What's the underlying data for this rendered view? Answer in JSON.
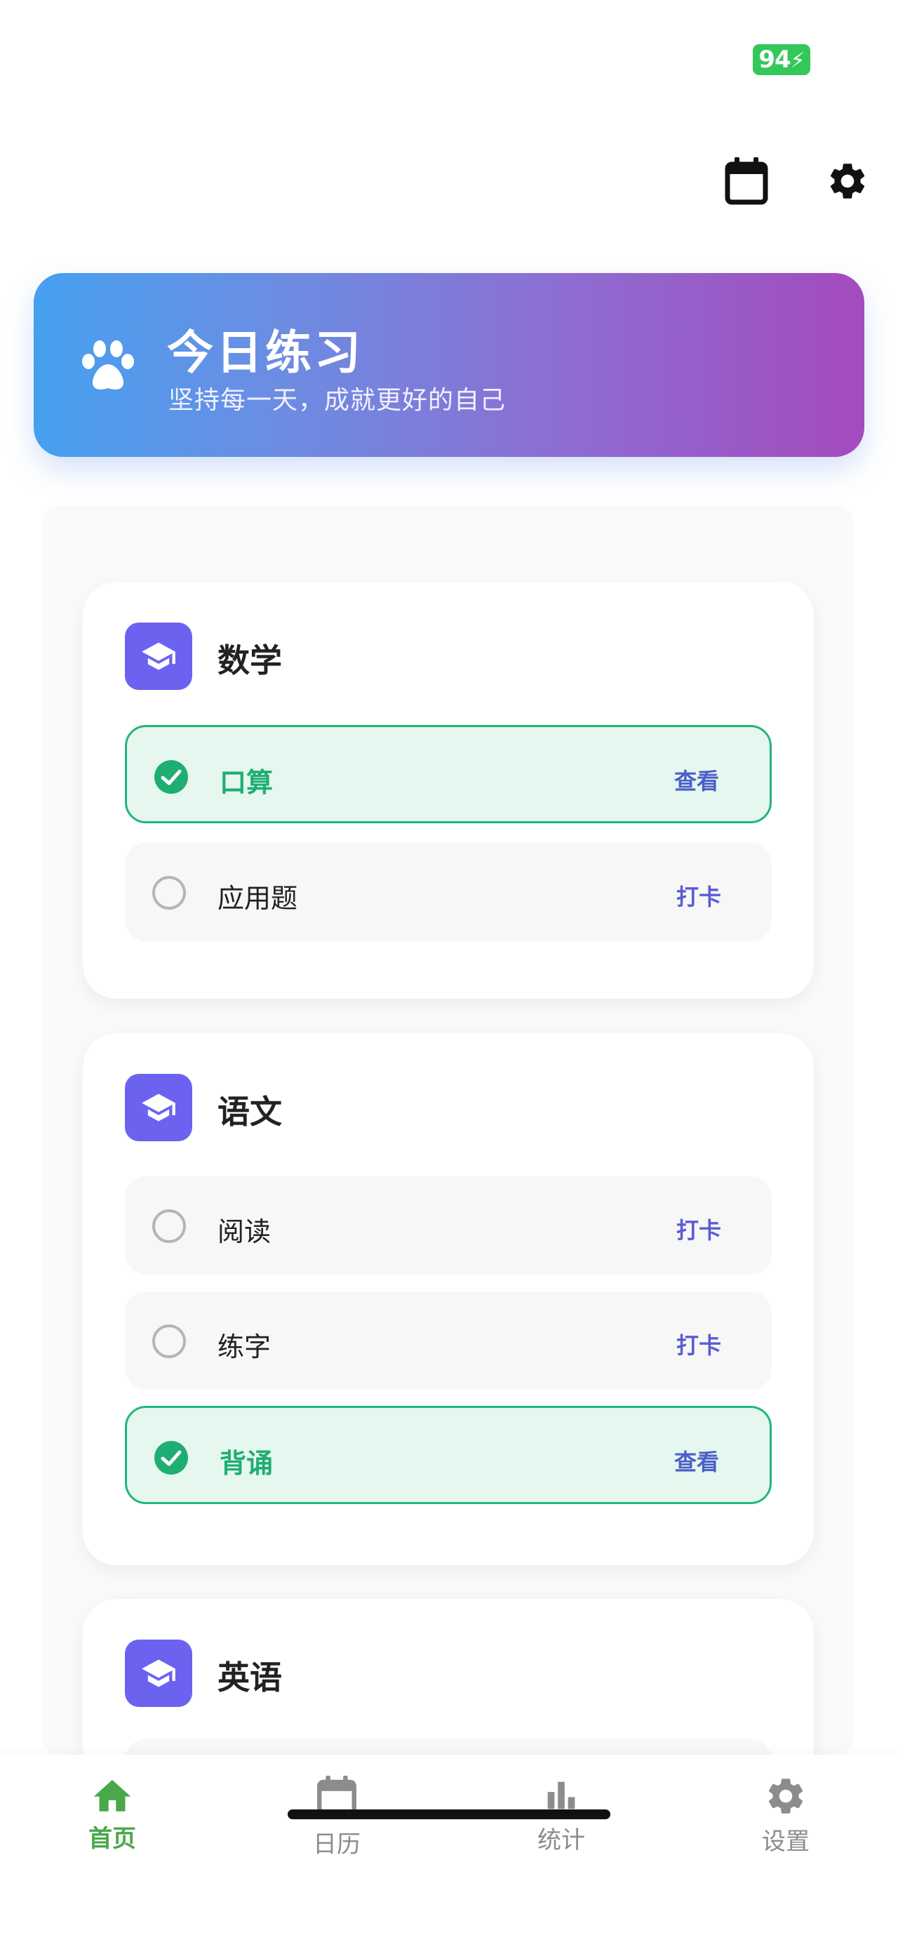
{
  "status_bar": {
    "battery": "94"
  },
  "header": {
    "calendar_icon": "calendar-icon",
    "settings_icon": "gear-icon"
  },
  "hero": {
    "icon": "paw-icon",
    "title": "今日练习",
    "subtitle": "坚持每一天，成就更好的自己"
  },
  "subjects": [
    {
      "title": "数学",
      "icon": "graduation-cap-icon",
      "tasks": [
        {
          "name": "口算",
          "done": true,
          "action": "查看"
        },
        {
          "name": "应用题",
          "done": false,
          "action": "打卡"
        }
      ]
    },
    {
      "title": "语文",
      "icon": "graduation-cap-icon",
      "tasks": [
        {
          "name": "阅读",
          "done": false,
          "action": "打卡"
        },
        {
          "name": "练字",
          "done": false,
          "action": "打卡"
        },
        {
          "name": "背诵",
          "done": true,
          "action": "查看"
        }
      ]
    },
    {
      "title": "英语",
      "icon": "graduation-cap-icon",
      "tasks": []
    }
  ],
  "nav": {
    "items": [
      {
        "label": "首页",
        "icon": "home-icon",
        "active": true
      },
      {
        "label": "日历",
        "icon": "calendar-icon",
        "active": false
      },
      {
        "label": "统计",
        "icon": "bar-chart-icon",
        "active": false
      },
      {
        "label": "设置",
        "icon": "gear-icon",
        "active": false
      }
    ]
  },
  "colors": {
    "accent": "#6b63f0",
    "done_green": "#22b67a",
    "nav_active": "#4aa84a",
    "hero_gradient": [
      "#46a0f0",
      "#a44bbe"
    ]
  }
}
